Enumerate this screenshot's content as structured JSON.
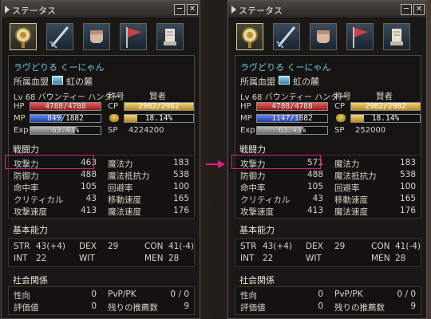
{
  "panels": [
    {
      "window_title": "ステータス",
      "min_glyph": "─",
      "close_glyph": "✕",
      "tabs": [
        "status-tab-icon",
        "skill-tab-icon",
        "action-tab-icon",
        "clan-tab-icon",
        "quest-tab-icon"
      ],
      "char_name": "ラヴどりる くーにゃん",
      "clan_label": "所属血盟",
      "clan_name": "虹の麓",
      "lv_label": "Lv",
      "lv_value": "68",
      "class_name": "バウンティー ハンター",
      "title_label": "称号",
      "title_value": "賢者",
      "hp_label": "HP",
      "hp_text": "4788/4788",
      "hp_ratio": 1.0,
      "mp_label": "MP",
      "mp_text": "849/1882",
      "mp_ratio": 0.451,
      "exp_label": "Exp",
      "exp_text": "63.43%",
      "exp_ratio": 0.6343,
      "cp_label": "CP",
      "cp_text": "2982/2982",
      "cp_ratio": 1.0,
      "weight_text": "18.14%",
      "weight_ratio": 0.1814,
      "sp_label": "SP",
      "sp_value": "4224200",
      "combat_head": "戦闘力",
      "combat": [
        [
          "攻撃力",
          "463",
          "魔法力",
          "183"
        ],
        [
          "防御力",
          "488",
          "魔法抵抗力",
          "538"
        ],
        [
          "命中率",
          "105",
          "回避率",
          "100"
        ],
        [
          "クリティカル",
          "43",
          "移動速度",
          "165"
        ],
        [
          "攻撃速度",
          "413",
          "魔法速度",
          "176"
        ]
      ],
      "basic_head": "基本能力",
      "basic": [
        [
          "STR",
          "43(+4)",
          "DEX",
          "29",
          "CON",
          "41(-4)"
        ],
        [
          "INT",
          "22",
          "WIT",
          "",
          "MEN",
          "28"
        ]
      ],
      "social_head": "社会関係",
      "social": [
        [
          "性向",
          "0",
          "PvP/PK",
          "0 / 0"
        ],
        [
          "評価値",
          "0",
          "残りの推薦数",
          "9"
        ]
      ]
    },
    {
      "window_title": "ステータス",
      "min_glyph": "─",
      "close_glyph": "✕",
      "tabs": [
        "status-tab-icon",
        "skill-tab-icon",
        "action-tab-icon",
        "clan-tab-icon",
        "quest-tab-icon"
      ],
      "char_name": "ラヴどりる くーにゃん",
      "clan_label": "所属血盟",
      "clan_name": "虹の麓",
      "lv_label": "Lv",
      "lv_value": "68",
      "class_name": "バウンティー ハンター",
      "title_label": "称号",
      "title_value": "賢者",
      "hp_label": "HP",
      "hp_text": "4788/4788",
      "hp_ratio": 1.0,
      "mp_label": "MP",
      "mp_text": "1147/1882",
      "mp_ratio": 0.609,
      "exp_label": "Exp",
      "exp_text": "63.43%",
      "exp_ratio": 0.6343,
      "cp_label": "CP",
      "cp_text": "2982/2982",
      "cp_ratio": 1.0,
      "weight_text": "18.14%",
      "weight_ratio": 0.1814,
      "sp_label": "SP",
      "sp_value": "252000",
      "combat_head": "戦闘力",
      "combat": [
        [
          "攻撃力",
          "571",
          "魔法力",
          "183"
        ],
        [
          "防御力",
          "488",
          "魔法抵抗力",
          "538"
        ],
        [
          "命中率",
          "105",
          "回避率",
          "100"
        ],
        [
          "クリティカル",
          "43",
          "移動速度",
          "165"
        ],
        [
          "攻撃速度",
          "413",
          "魔法速度",
          "176"
        ]
      ],
      "basic_head": "基本能力",
      "basic": [
        [
          "STR",
          "43(+4)",
          "DEX",
          "29",
          "CON",
          "41(-4)"
        ],
        [
          "INT",
          "22",
          "WIT",
          "",
          "MEN",
          "28"
        ]
      ],
      "social_head": "社会関係",
      "social": [
        [
          "性向",
          "0",
          "PvP/PK",
          "0 / 0"
        ],
        [
          "評価値",
          "0",
          "残りの推薦数",
          "9"
        ]
      ]
    }
  ],
  "colors": {
    "highlight": "#e0208a",
    "arrow": "#e0208a",
    "char_name": "#70c8e0"
  }
}
